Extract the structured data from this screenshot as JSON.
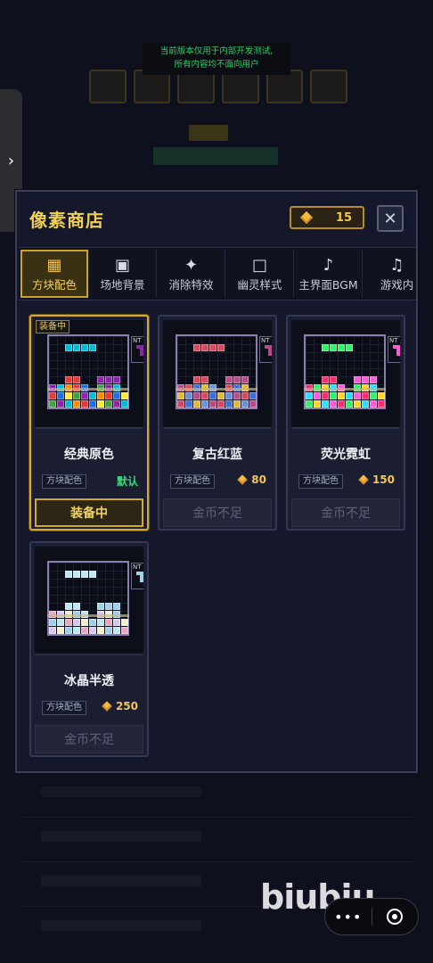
{
  "dev_notice": {
    "line1": "当前版本仅用于内部开发测试,",
    "line2": "所有内容均不面向用户"
  },
  "side_tab": {
    "icon": "chevron-right-icon",
    "glyph": "›"
  },
  "shop": {
    "title": "像素商店",
    "coins": "15",
    "close_glyph": "✕"
  },
  "tabs": [
    {
      "label": "方块配色",
      "icon": "grid-icon",
      "glyph": "▦",
      "active": true
    },
    {
      "label": "场地背景",
      "icon": "frame-square-icon",
      "glyph": "▣",
      "active": false
    },
    {
      "label": "消除特效",
      "icon": "sparkle-icon",
      "glyph": "✦",
      "active": false
    },
    {
      "label": "幽灵样式",
      "icon": "hollow-square-icon",
      "glyph": "□",
      "active": false
    },
    {
      "label": "主界面BGM",
      "icon": "music-note-icon",
      "glyph": "♪",
      "active": false
    },
    {
      "label": "游戏内",
      "icon": "double-note-icon",
      "glyph": "♫",
      "active": false
    }
  ],
  "items": [
    {
      "name": "经典原色",
      "tag": "方块配色",
      "status": "默认",
      "price": "",
      "badge": "装备中",
      "button": "装备中",
      "equipped": true
    },
    {
      "name": "复古红蓝",
      "tag": "方块配色",
      "status": "",
      "price": "80",
      "badge": "",
      "button": "金币不足",
      "equipped": false
    },
    {
      "name": "荧光霓虹",
      "tag": "方块配色",
      "status": "",
      "price": "150",
      "badge": "",
      "button": "金币不足",
      "equipped": false
    },
    {
      "name": "冰晶半透",
      "tag": "方块配色",
      "status": "",
      "price": "250",
      "badge": "",
      "button": "金币不足",
      "equipped": false
    }
  ],
  "preview_label": "NT",
  "watermark": "biubiu",
  "capsule": {
    "more": "•••"
  },
  "colors": {
    "accent_gold": "#d6aa2a",
    "title_yellow": "#f0d050",
    "default_green": "#3fd67a",
    "classic": [
      "#e53935",
      "#1e6fe0",
      "#ffeb3b",
      "#43a047",
      "#8e24aa",
      "#00bcd4",
      "#fb8c00"
    ],
    "retro": [
      "#d9485e",
      "#3c6fd8",
      "#e0b83a",
      "#6d8fe0",
      "#b94a8c"
    ],
    "neon": [
      "#ff2d6f",
      "#31f06a",
      "#ffd52a",
      "#2ae0ff",
      "#ff5ad8"
    ],
    "ice": [
      "#bfe6f2",
      "#e9a8bd",
      "#d7c9f0",
      "#f3f0d0",
      "#9fd2e8"
    ]
  }
}
